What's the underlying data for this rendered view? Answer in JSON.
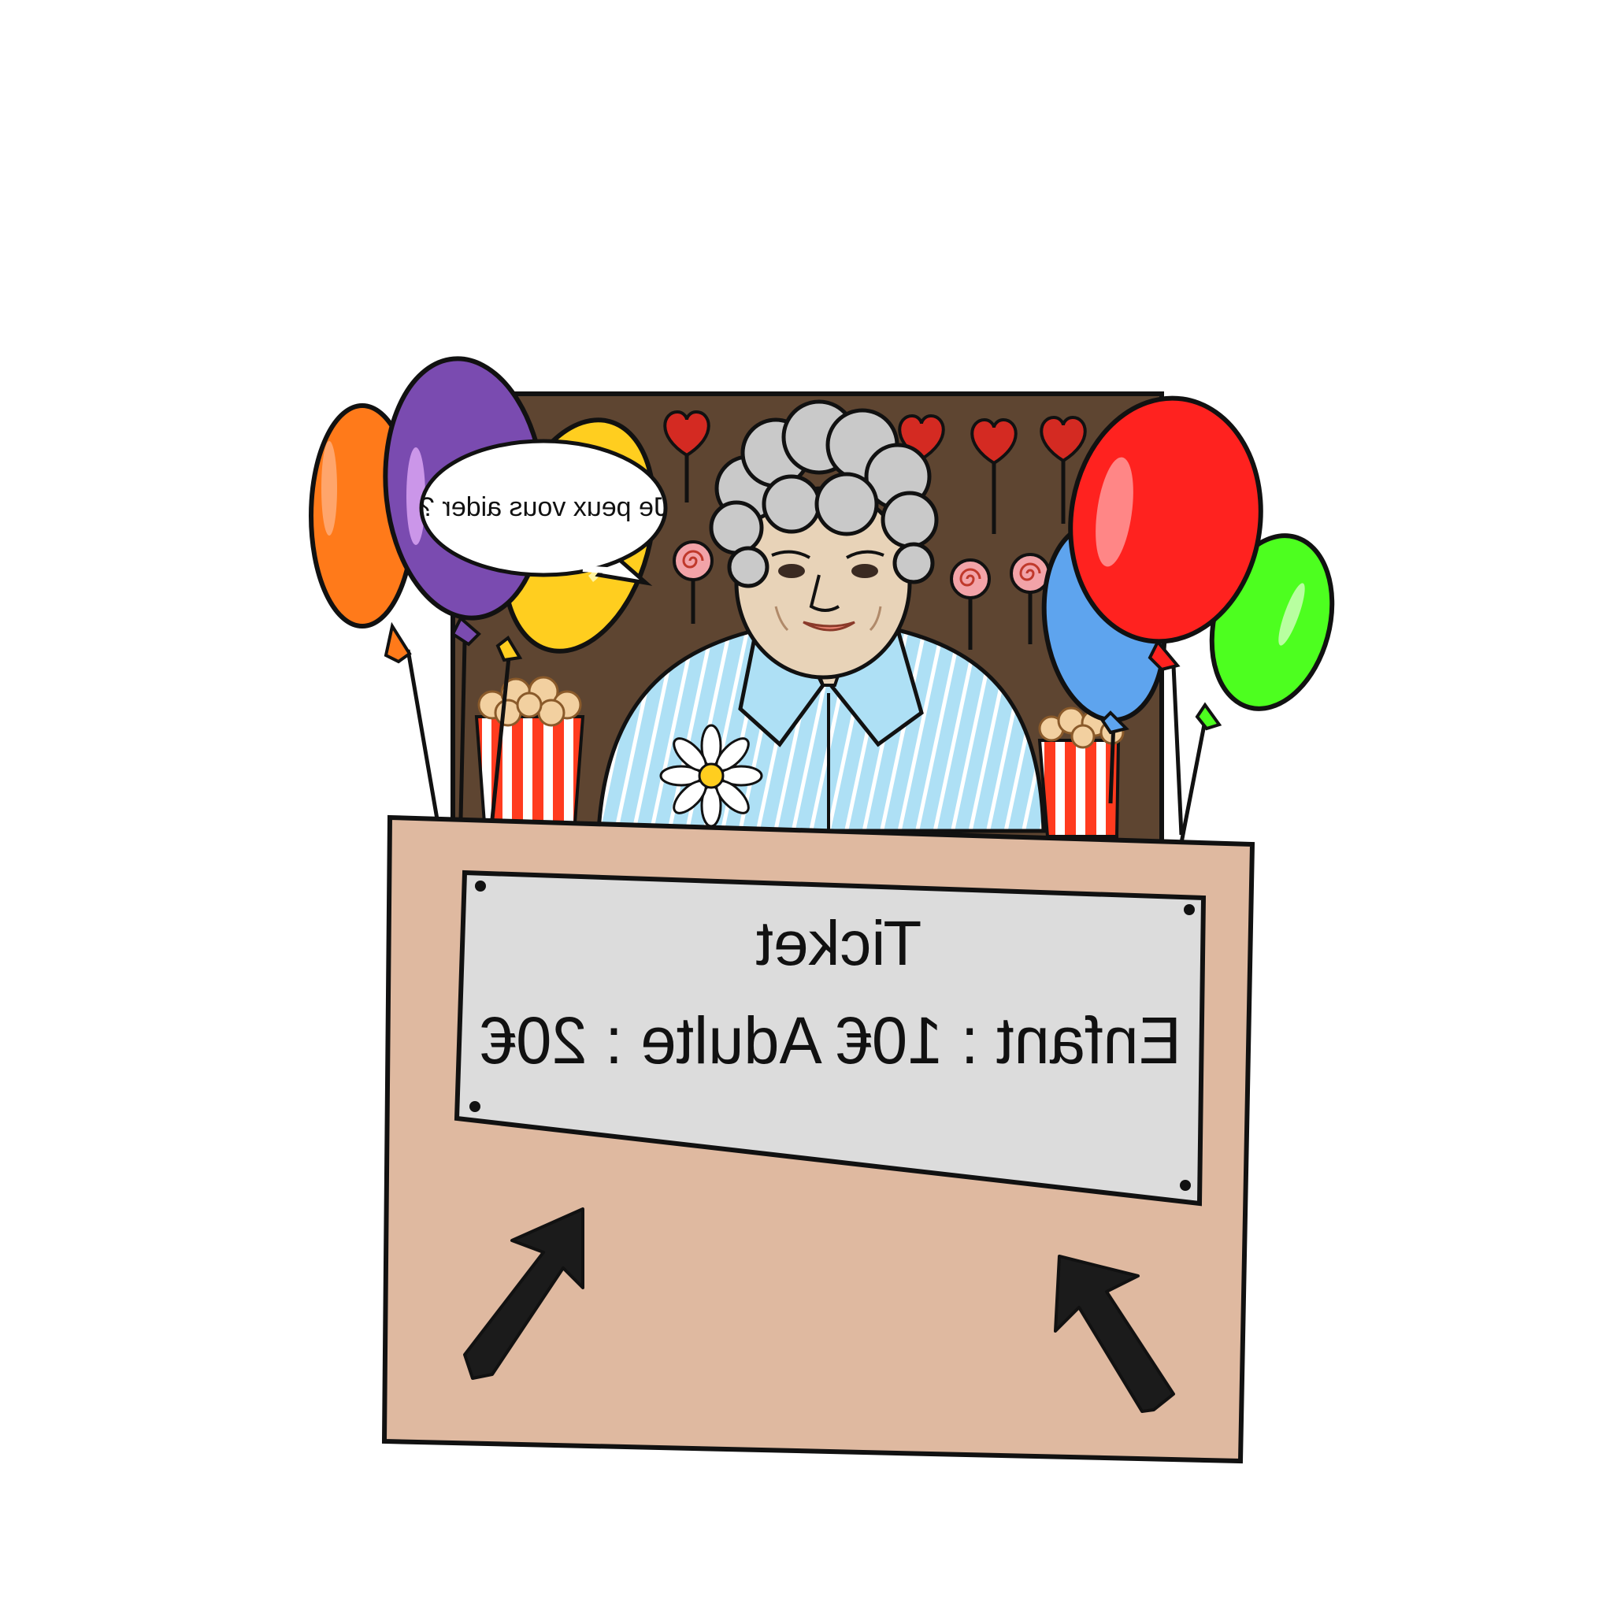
{
  "scene": {
    "background_color": "#ffffff",
    "booth_wall_color": "#5e4531",
    "counter_color": "#dfb9a0",
    "sign_plate_color": "#dcdcdc"
  },
  "speech_bubble": {
    "text": "Je peux vous aider ?",
    "mirrored": true
  },
  "ticket_sign": {
    "title": "Ticket",
    "prices": "Enfant : 10€ Adulte : 20€",
    "mirrored": true
  },
  "balloons": {
    "left": [
      {
        "color": "#ff7a1a",
        "name": "orange"
      },
      {
        "color": "#7a4bb0",
        "name": "purple"
      },
      {
        "color": "#ffce1f",
        "name": "yellow"
      }
    ],
    "right": [
      {
        "color": "#5ea4ee",
        "name": "blue"
      },
      {
        "color": "#ff221f",
        "name": "red"
      },
      {
        "color": "#4dff1f",
        "name": "green"
      }
    ]
  },
  "decorations": {
    "heart_lollipop_color": "#d42a22",
    "spiral_lollipop_color": "#f2a3a8",
    "popcorn_box_colors": [
      "#ff3b1f",
      "#ffffff"
    ],
    "popcorn_color": "#f2d0a0"
  },
  "character": {
    "description_icon": "elderly-cashier-figure",
    "hair_color": "#c9c9c9",
    "skin_color": "#e8d3b8",
    "shirt_color": "#aee0f5",
    "flower": "daisy-icon"
  },
  "arrows": {
    "color": "#1b1b1b",
    "count": 2
  }
}
